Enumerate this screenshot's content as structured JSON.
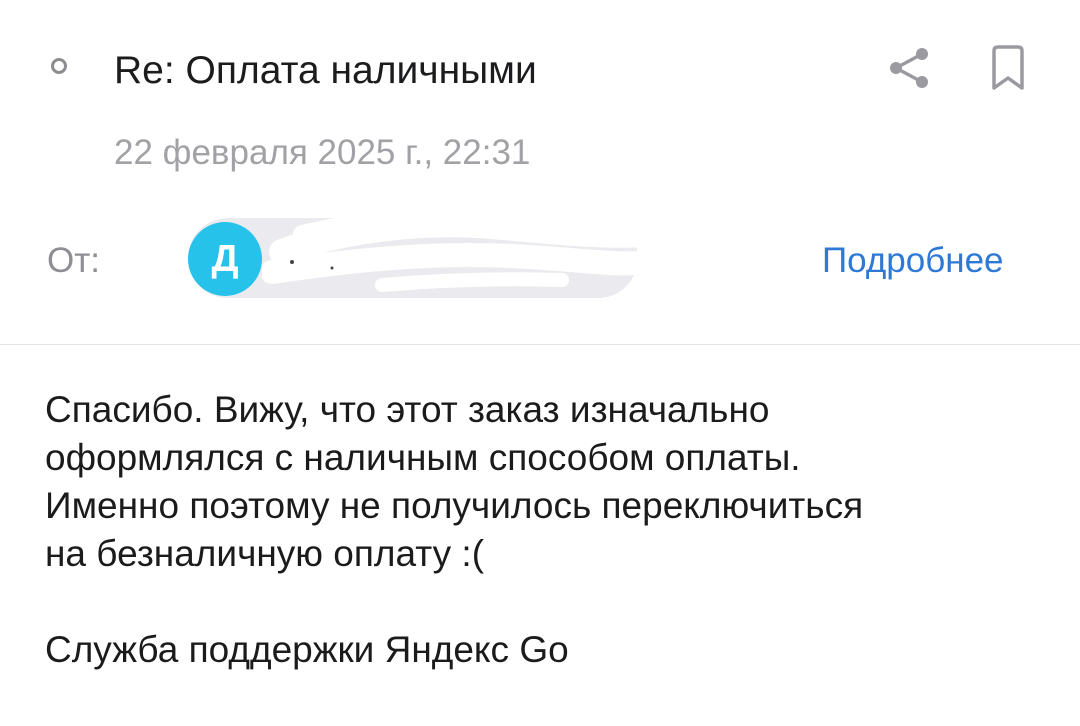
{
  "header": {
    "subject": "Re: Оплата наличными",
    "date": "22 февраля 2025 г., 22:31",
    "share_icon": "share-icon",
    "bookmark_icon": "bookmark-icon"
  },
  "sender": {
    "from_label": "От:",
    "avatar_letter": "Д",
    "details_link": "Подробнее",
    "colors": {
      "avatar": "#27c2ea",
      "link": "#2e78d6"
    }
  },
  "message": {
    "lines": [
      "Спасибо. Вижу, что этот заказ изначально",
      "оформлялся с наличным способом оплаты.",
      "Именно поэтому не получилось переключиться",
      "на безналичную оплату :("
    ],
    "signature": "Служба поддержки Яндекс Go"
  }
}
